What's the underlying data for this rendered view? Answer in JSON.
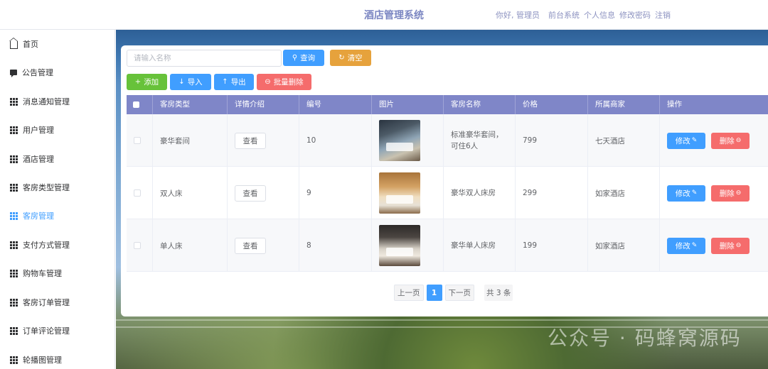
{
  "header": {
    "title": "酒店管理系统",
    "greeting": "你好, 管理员",
    "links": [
      "前台系统",
      "个人信息",
      "修改密码",
      "注销"
    ]
  },
  "sidebar": {
    "items": [
      {
        "label": "首页",
        "icon": "home-icon"
      },
      {
        "label": "公告管理",
        "icon": "chat-icon"
      },
      {
        "label": "消息通知管理",
        "icon": "grid-icon"
      },
      {
        "label": "用户管理",
        "icon": "grid-icon"
      },
      {
        "label": "酒店管理",
        "icon": "grid-icon"
      },
      {
        "label": "客房类型管理",
        "icon": "grid-icon"
      },
      {
        "label": "客房管理",
        "icon": "grid-icon",
        "active": true
      },
      {
        "label": "支付方式管理",
        "icon": "grid-icon"
      },
      {
        "label": "购物车管理",
        "icon": "grid-icon"
      },
      {
        "label": "客房订单管理",
        "icon": "grid-icon"
      },
      {
        "label": "订单评论管理",
        "icon": "grid-icon"
      },
      {
        "label": "轮播图管理",
        "icon": "grid-icon"
      }
    ]
  },
  "search": {
    "placeholder": "请输入名称",
    "value": ""
  },
  "toolbar": {
    "query": "查询",
    "clear": "清空",
    "add": "添加",
    "import": "导入",
    "export": "导出",
    "batch_delete": "批量删除"
  },
  "table": {
    "headers": [
      "客房类型",
      "详情介绍",
      "编号",
      "图片",
      "客房名称",
      "价格",
      "所属商家",
      "操作"
    ],
    "rows": [
      {
        "type": "豪华套间",
        "detail": "查看",
        "id": "10",
        "name": "标准豪华套间，可住6人",
        "price": "799",
        "merchant": "七天酒店",
        "edit": "修改",
        "delete": "删除"
      },
      {
        "type": "双人床",
        "detail": "查看",
        "id": "9",
        "name": "豪华双人床房",
        "price": "299",
        "merchant": "如家酒店",
        "edit": "修改",
        "delete": "删除"
      },
      {
        "type": "单人床",
        "detail": "查看",
        "id": "8",
        "name": "豪华单人床房",
        "price": "199",
        "merchant": "如家酒店",
        "edit": "修改",
        "delete": "删除"
      }
    ]
  },
  "pagination": {
    "prev": "上一页",
    "current": "1",
    "next": "下一页",
    "total": "共 3 条"
  },
  "watermark": "公众号 · 码蜂窝源码",
  "colors": {
    "primary": "#409eff",
    "success": "#67c23a",
    "warning": "#e6a23c",
    "danger": "#f56c6c",
    "table_header": "#7f86c8",
    "title": "#7b86c2"
  }
}
